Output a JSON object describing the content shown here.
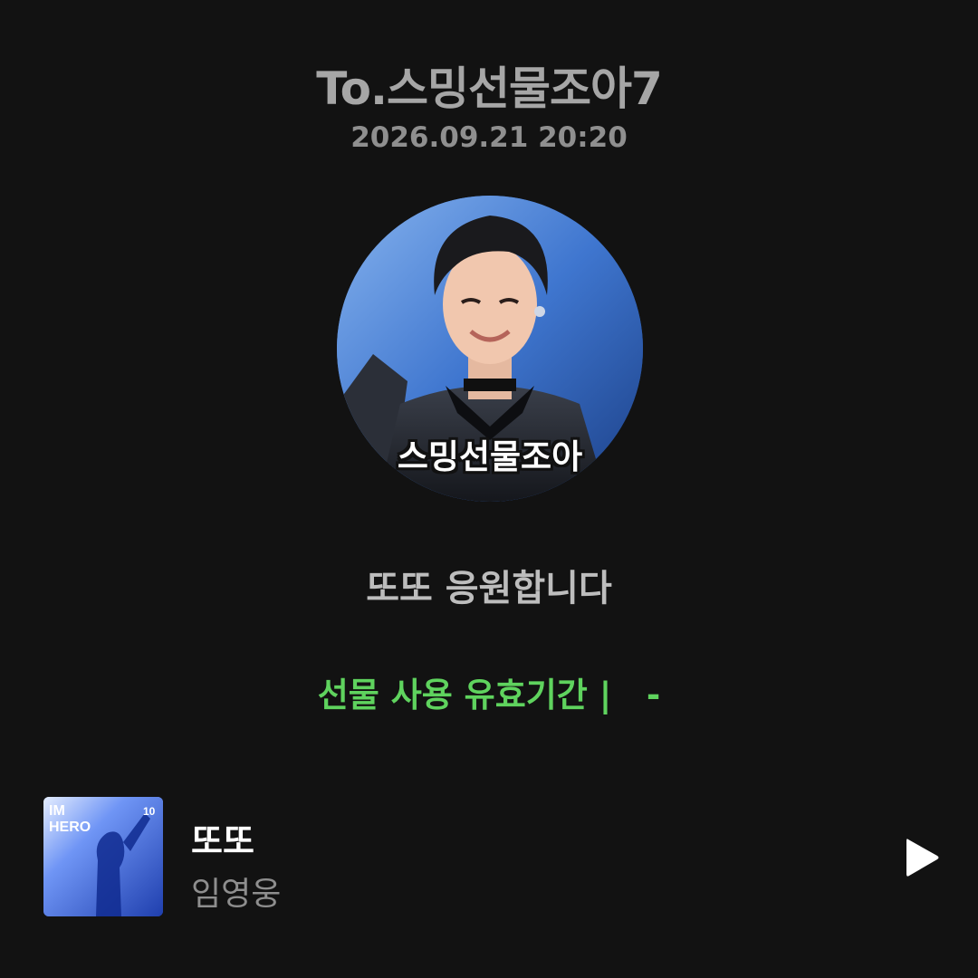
{
  "header": {
    "recipient": "To.스밍선물조아7",
    "timestamp": "2026.09.21 20:20"
  },
  "avatar": {
    "caption": "스밍선물조아"
  },
  "message": "또또 응원합니다",
  "validity": "선물 사용 유효기간 |   -",
  "track": {
    "title": "또또",
    "artist": "임영웅",
    "album_art_text": "IM HERO"
  },
  "colors": {
    "background": "#121212",
    "accent_green": "#5fd35e",
    "title_white": "#ffffff",
    "muted_gray": "#8e8e8e"
  },
  "icons": {
    "play": "play-icon"
  }
}
